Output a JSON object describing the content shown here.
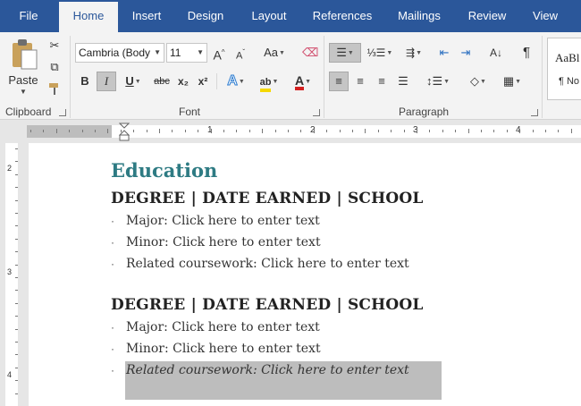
{
  "tabs": [
    "File",
    "Home",
    "Insert",
    "Design",
    "Layout",
    "References",
    "Mailings",
    "Review",
    "View"
  ],
  "ribbon": {
    "clipboard": {
      "label": "Clipboard",
      "paste": "Paste"
    },
    "font": {
      "label": "Font",
      "font_name": "Cambria (Body",
      "font_size": "11",
      "change_case": "Aa",
      "bold": "B",
      "italic": "I",
      "underline": "U",
      "strikethrough": "abc",
      "subscript": "x₂",
      "superscript": "x²",
      "text_effects": "A",
      "highlight": "ab",
      "font_color": "A",
      "grow": "A",
      "shrink": "A"
    },
    "paragraph": {
      "label": "Paragraph"
    },
    "styles": {
      "preview": "AaBl",
      "name": "¶ No"
    }
  },
  "ruler": [
    "1",
    "2",
    "3",
    "4"
  ],
  "vruler": [
    "2",
    "3",
    "4"
  ],
  "document": {
    "section_title": "Education",
    "entries": [
      {
        "heading": "DEGREE | DATE EARNED | SCHOOL",
        "bullets": [
          "Major: Click here to enter text",
          "Minor: Click here to enter text",
          "Related coursework: Click here to enter text"
        ]
      },
      {
        "heading": "DEGREE | DATE EARNED | SCHOOL",
        "bullets": [
          "Major: Click here to enter text",
          "Minor: Click here to enter text",
          "Related coursework: Click here to enter text"
        ]
      }
    ]
  },
  "colors": {
    "tab_bar": "#2b579a",
    "section_title": "#2e7b83",
    "highlight": "#f5d800",
    "font_color": "#d42020",
    "selection": "#bdbdbd"
  },
  "icons": [
    "cut-icon",
    "copy-icon",
    "format-painter-icon",
    "clear-formatting-icon",
    "bullets-icon",
    "numbering-icon",
    "multilevel-list-icon",
    "decrease-indent-icon",
    "increase-indent-icon",
    "sort-icon",
    "pilcrow-icon",
    "align-left-icon",
    "align-center-icon",
    "align-right-icon",
    "justify-icon",
    "line-spacing-icon",
    "shading-icon",
    "borders-icon"
  ]
}
